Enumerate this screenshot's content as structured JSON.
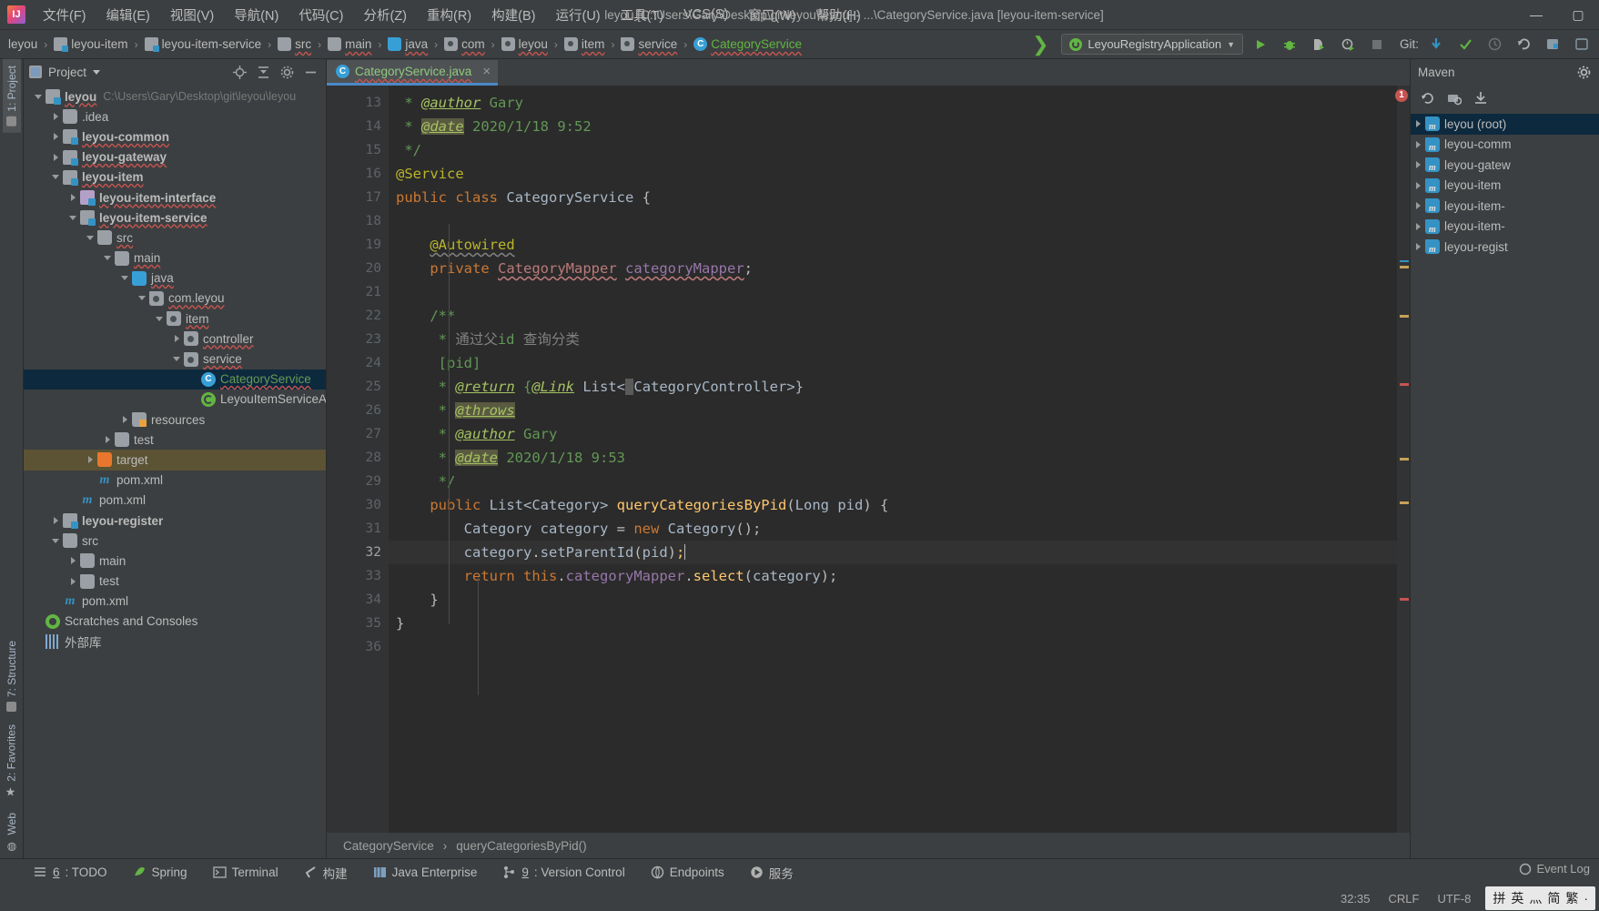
{
  "titlebar": {
    "logo": "IJ",
    "menus": [
      "文件(F)",
      "编辑(E)",
      "视图(V)",
      "导航(N)",
      "代码(C)",
      "分析(Z)",
      "重构(R)",
      "构建(B)",
      "运行(U)",
      "工具(T)",
      "VCS(S)",
      "窗口(W)",
      "帮助(H)"
    ],
    "window_title": "leyou [C:\\Users\\Gary\\Desktop\\git\\leyou\\leyou] - ...\\CategoryService.java [leyou-item-service]",
    "minimize": "—",
    "maximize": "▢"
  },
  "navbar": {
    "breadcrumbs": [
      {
        "label": "leyou",
        "icon": "none"
      },
      {
        "label": "leyou-item",
        "icon": "module"
      },
      {
        "label": "leyou-item-service",
        "icon": "module"
      },
      {
        "label": "src",
        "icon": "folder"
      },
      {
        "label": "main",
        "icon": "folder"
      },
      {
        "label": "java",
        "icon": "folder-blue"
      },
      {
        "label": "com",
        "icon": "package"
      },
      {
        "label": "leyou",
        "icon": "package"
      },
      {
        "label": "item",
        "icon": "package"
      },
      {
        "label": "service",
        "icon": "package"
      },
      {
        "label": "CategoryService",
        "icon": "class"
      }
    ],
    "run_config": "LeyouRegistryApplication",
    "run_config_caret": "▼",
    "git_label": "Git:",
    "icons": [
      "build-icon",
      "run-icon",
      "debug-icon",
      "run-with-coverage-icon",
      "profile-icon",
      "stop-icon",
      "git-update-icon",
      "git-commit-icon",
      "git-history-icon",
      "git-rollback-icon",
      "settings-icon",
      "search-icon"
    ]
  },
  "left_strip": {
    "top_tabs": [
      "1: Project"
    ],
    "bottom_tabs": [
      "7: Structure",
      "2: Favorites",
      "Web"
    ]
  },
  "project_panel": {
    "title": "Project",
    "actions": [
      "locate-icon",
      "collapse-all-icon",
      "settings-icon",
      "hide-icon"
    ],
    "tree": [
      {
        "depth": 0,
        "arrow": "open",
        "icon": "module",
        "label": "leyou",
        "bold": true,
        "wavy": true,
        "path": "C:\\Users\\Gary\\Desktop\\git\\leyou\\leyou"
      },
      {
        "depth": 1,
        "arrow": "closed",
        "icon": "folder",
        "label": ".idea"
      },
      {
        "depth": 1,
        "arrow": "closed",
        "icon": "module",
        "label": "leyou-common",
        "bold": true,
        "wavy": true
      },
      {
        "depth": 1,
        "arrow": "closed",
        "icon": "module",
        "label": "leyou-gateway",
        "bold": true,
        "wavy": true
      },
      {
        "depth": 1,
        "arrow": "open",
        "icon": "module",
        "label": "leyou-item",
        "bold": true,
        "wavy": true
      },
      {
        "depth": 2,
        "arrow": "closed",
        "icon": "module-purple",
        "label": "leyou-item-interface",
        "bold": true,
        "wavy": true
      },
      {
        "depth": 2,
        "arrow": "open",
        "icon": "module",
        "label": "leyou-item-service",
        "bold": true,
        "wavy": true
      },
      {
        "depth": 3,
        "arrow": "open",
        "icon": "folder",
        "label": "src",
        "wavy": true
      },
      {
        "depth": 4,
        "arrow": "open",
        "icon": "folder",
        "label": "main",
        "wavy": true
      },
      {
        "depth": 5,
        "arrow": "open",
        "icon": "folder-blue",
        "label": "java",
        "wavy": true
      },
      {
        "depth": 6,
        "arrow": "open",
        "icon": "package",
        "label": "com.leyou",
        "wavy": true
      },
      {
        "depth": 7,
        "arrow": "open",
        "icon": "package",
        "label": "item",
        "wavy": true
      },
      {
        "depth": 8,
        "arrow": "closed",
        "icon": "package",
        "label": "controller",
        "wavy": true
      },
      {
        "depth": 8,
        "arrow": "open",
        "icon": "package",
        "label": "service",
        "wavy": true
      },
      {
        "depth": 9,
        "arrow": "none",
        "icon": "class",
        "label": "CategoryService",
        "selected": true,
        "green": true,
        "wavy": true
      },
      {
        "depth": 9,
        "arrow": "none",
        "icon": "spring",
        "label": "LeyouItemServiceApplic"
      },
      {
        "depth": 5,
        "arrow": "closed",
        "icon": "folder-res",
        "label": "resources"
      },
      {
        "depth": 4,
        "arrow": "closed",
        "icon": "folder",
        "label": "test"
      },
      {
        "depth": 3,
        "arrow": "closed",
        "icon": "folder-orange",
        "label": "target",
        "highlight": true
      },
      {
        "depth": 3,
        "arrow": "none",
        "icon": "maven",
        "label": "pom.xml"
      },
      {
        "depth": 2,
        "arrow": "none",
        "icon": "maven",
        "label": "pom.xml"
      },
      {
        "depth": 1,
        "arrow": "closed",
        "icon": "module",
        "label": "leyou-register",
        "bold": true
      },
      {
        "depth": 1,
        "arrow": "open",
        "icon": "folder",
        "label": "src"
      },
      {
        "depth": 2,
        "arrow": "closed",
        "icon": "folder",
        "label": "main"
      },
      {
        "depth": 2,
        "arrow": "closed",
        "icon": "folder",
        "label": "test"
      },
      {
        "depth": 1,
        "arrow": "none",
        "icon": "maven",
        "label": "pom.xml"
      },
      {
        "depth": 0,
        "arrow": "none",
        "icon": "scratch",
        "label": "Scratches and Consoles"
      },
      {
        "depth": 0,
        "arrow": "none",
        "icon": "library",
        "label": "外部库"
      }
    ]
  },
  "editor": {
    "tab": {
      "label": "CategoryService.java",
      "close": "×",
      "icon": "class-icon"
    },
    "first_line": 13,
    "cursor_line": 32,
    "lines": [
      {
        "n": 13,
        "text": " * @author Gary"
      },
      {
        "n": 14,
        "text": " * @date 2020/1/18 9:52"
      },
      {
        "n": 15,
        "text": " */",
        "fold": "end"
      },
      {
        "n": 16,
        "text": "@Service"
      },
      {
        "n": 17,
        "text": "public class CategoryService {",
        "gutter_icon": "spring-bean-icon"
      },
      {
        "n": 18,
        "text": ""
      },
      {
        "n": 19,
        "text": "    @Autowired"
      },
      {
        "n": 20,
        "text": "    private CategoryMapper categoryMapper;"
      },
      {
        "n": 21,
        "text": ""
      },
      {
        "n": 22,
        "text": "    /**",
        "fold": "start"
      },
      {
        "n": 23,
        "text": "     * 通过父id 查询分类"
      },
      {
        "n": 24,
        "text": "     [pid]"
      },
      {
        "n": 25,
        "text": "     * @return {@Link List< CategoryController>}"
      },
      {
        "n": 26,
        "text": "     * @throws"
      },
      {
        "n": 27,
        "text": "     * @author Gary"
      },
      {
        "n": 28,
        "text": "     * @date 2020/1/18 9:53"
      },
      {
        "n": 29,
        "text": "     */",
        "fold": "end"
      },
      {
        "n": 30,
        "text": "    public List<Category> queryCategoriesByPid(Long pid) {",
        "fold": "start"
      },
      {
        "n": 31,
        "text": "        Category category = new Category();"
      },
      {
        "n": 32,
        "text": "        category.setParentId(pid);"
      },
      {
        "n": 33,
        "text": "        return this.categoryMapper.select(category);"
      },
      {
        "n": 34,
        "text": "    }",
        "fold": "end"
      },
      {
        "n": 35,
        "text": "}"
      },
      {
        "n": 36,
        "text": ""
      }
    ],
    "error_count": "1",
    "breadcrumbs": [
      "CategoryService",
      "queryCategoriesByPid()"
    ],
    "breadcrumb_sep": "›"
  },
  "maven_panel": {
    "title": "Maven",
    "settings_icon": "gear-icon",
    "toolbar_icons": [
      "reload-icon",
      "add-maven-project-icon",
      "download-sources-icon"
    ],
    "items": [
      {
        "label": "leyou (root)",
        "selected": true
      },
      {
        "label": "leyou-comm"
      },
      {
        "label": "leyou-gatew"
      },
      {
        "label": "leyou-item"
      },
      {
        "label": "leyou-item-"
      },
      {
        "label": "leyou-item-"
      },
      {
        "label": "leyou-regist"
      }
    ]
  },
  "bottom_tools": [
    {
      "num": "6",
      "label": ": TODO",
      "icon": "todo-icon"
    },
    {
      "num": "",
      "label": "Spring",
      "icon": "spring-icon"
    },
    {
      "num": "",
      "label": "Terminal",
      "icon": "terminal-icon"
    },
    {
      "num": "",
      "label": "构建",
      "icon": "build-icon"
    },
    {
      "num": "",
      "label": "Java Enterprise",
      "icon": "java-enterprise-icon"
    },
    {
      "num": "9",
      "label": ": Version Control",
      "icon": "version-control-icon"
    },
    {
      "num": "",
      "label": "Endpoints",
      "icon": "endpoints-icon"
    },
    {
      "num": "",
      "label": "服务",
      "icon": "services-icon"
    }
  ],
  "statusbar": {
    "event_log": "Event Log",
    "caret_position": "32:35",
    "line_separator": "CRLF",
    "encoding": "UTF-8",
    "ime": [
      "拼",
      "英",
      "灬",
      "简",
      "繁",
      "·"
    ]
  },
  "colors": {
    "accent": "#4a88c7",
    "selection": "#0d293e",
    "highlight": "#5b5333",
    "error": "#c75450",
    "keyword": "#cc7832",
    "string": "#6a8759",
    "comment": "#629755",
    "method": "#ffc66d",
    "field": "#9876aa",
    "annotation": "#bbb529",
    "green": "#62b543"
  }
}
